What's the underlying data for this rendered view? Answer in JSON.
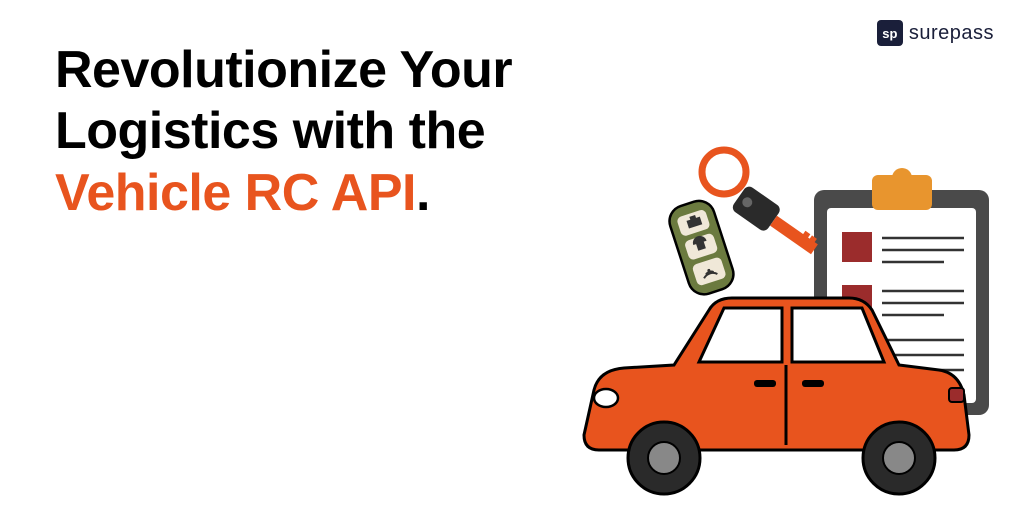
{
  "brand": {
    "icon_text": "sp",
    "name": "surepass"
  },
  "headline": {
    "line1": "Revolutionize Your",
    "line2": "Logistics with the",
    "highlight": "Vehicle RC API",
    "trailing_period": "."
  },
  "colors": {
    "accent": "#e8541e",
    "brand_dark": "#1a1f3a"
  }
}
